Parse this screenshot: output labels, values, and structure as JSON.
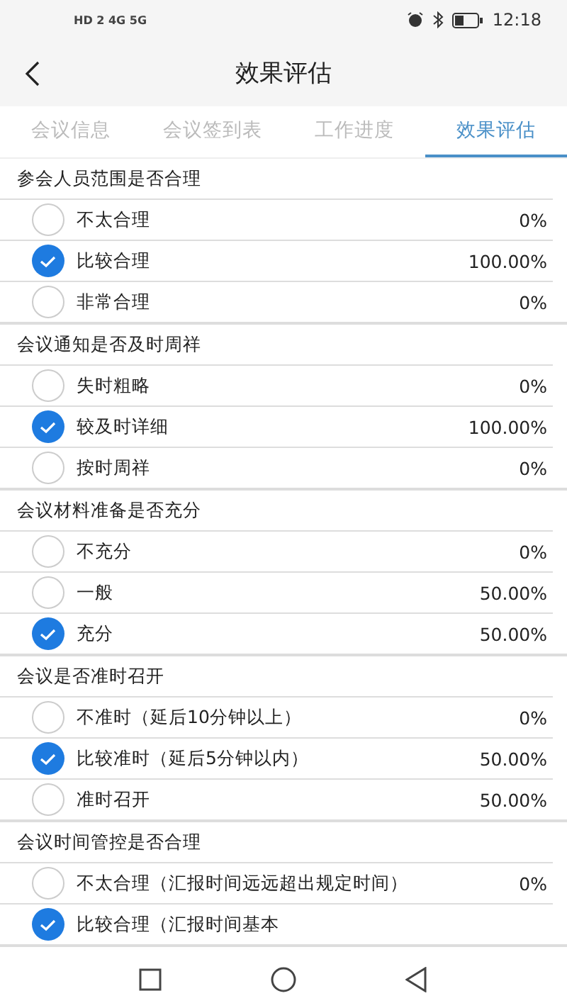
{
  "status_bar": {
    "left": "HD 2 4G 5G",
    "time": "12:18"
  },
  "header": {
    "title": "效果评估"
  },
  "tabs": [
    {
      "label": "会议信息",
      "selected": false
    },
    {
      "label": "会议签到表",
      "selected": false
    },
    {
      "label": "工作进度",
      "selected": false
    },
    {
      "label": "效果评估",
      "selected": true
    }
  ],
  "questions": [
    {
      "title": "参会人员范围是否合理",
      "options": [
        {
          "label": "不太合理",
          "percent": "0%",
          "selected": false
        },
        {
          "label": "比较合理",
          "percent": "100.00%",
          "selected": true
        },
        {
          "label": "非常合理",
          "percent": "0%",
          "selected": false
        }
      ]
    },
    {
      "title": "会议通知是否及时周祥",
      "options": [
        {
          "label": "失时粗略",
          "percent": "0%",
          "selected": false
        },
        {
          "label": "较及时详细",
          "percent": "100.00%",
          "selected": true
        },
        {
          "label": "按时周祥",
          "percent": "0%",
          "selected": false
        }
      ]
    },
    {
      "title": "会议材料准备是否充分",
      "options": [
        {
          "label": "不充分",
          "percent": "0%",
          "selected": false
        },
        {
          "label": "一般",
          "percent": "50.00%",
          "selected": false
        },
        {
          "label": "充分",
          "percent": "50.00%",
          "selected": true
        }
      ]
    },
    {
      "title": "会议是否准时召开",
      "options": [
        {
          "label": "不准时（延后10分钟以上）",
          "percent": "0%",
          "selected": false
        },
        {
          "label": "比较准时（延后5分钟以内）",
          "percent": "50.00%",
          "selected": true
        },
        {
          "label": "准时召开",
          "percent": "50.00%",
          "selected": false
        }
      ]
    },
    {
      "title": "会议时间管控是否合理",
      "options": [
        {
          "label": "不太合理（汇报时间远远超出规定时间）",
          "percent": "0%",
          "selected": false
        },
        {
          "label": "比较合理（汇报时间基本",
          "selected": true
        }
      ]
    }
  ]
}
